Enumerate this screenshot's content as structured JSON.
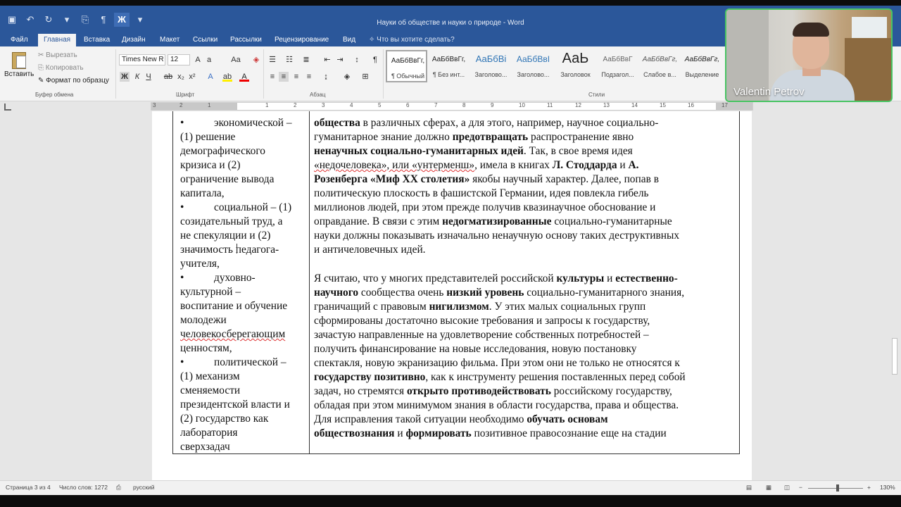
{
  "window": {
    "title": "Науки об обществе и науки о природе - Word"
  },
  "menu": {
    "tabs": [
      "Файл",
      "Главная",
      "Вставка",
      "Дизайн",
      "Макет",
      "Ссылки",
      "Рассылки",
      "Рецензирование",
      "Вид"
    ],
    "active": "Главная",
    "tell_me": "Что вы хотите сделать?"
  },
  "ribbon": {
    "clipboard": {
      "paste": "Вставить",
      "cut": "Вырезать",
      "copy": "Копировать",
      "format_painter": "Формат по образцу",
      "label": "Буфер обмена"
    },
    "font": {
      "name": "Times New R",
      "size": "12",
      "label": "Шрифт"
    },
    "paragraph": {
      "label": "Абзац"
    },
    "styles": {
      "label": "Стили",
      "items": [
        {
          "preview": "АаБбВвГг,",
          "name": "¶ Обычный"
        },
        {
          "preview": "АаБбВвГг,",
          "name": "¶ Без инт..."
        },
        {
          "preview": "АаБбВі",
          "name": "Заголово..."
        },
        {
          "preview": "АаБбВвІ",
          "name": "Заголово..."
        },
        {
          "preview": "АаЬ",
          "name": "Заголовок"
        },
        {
          "preview": "АаБбВвГ",
          "name": "Подзагол..."
        },
        {
          "preview": "АаБбВвГг,",
          "name": "Слабое в..."
        },
        {
          "preview": "АаБбВвГг,",
          "name": "Выделение"
        }
      ]
    }
  },
  "ruler": {
    "numbers": [
      "3",
      "2",
      "1",
      "1",
      "2",
      "3",
      "4",
      "5",
      "6",
      "7",
      "8",
      "9",
      "10",
      "11",
      "12",
      "13",
      "14",
      "15",
      "16",
      "17"
    ]
  },
  "document": {
    "left_column": [
      {
        "text": "экономической –",
        "bullet": true
      },
      {
        "text": "(1) решение"
      },
      {
        "text": "демографического"
      },
      {
        "text": "кризиса и (2)"
      },
      {
        "text": "ограничение вывода"
      },
      {
        "text": "капитала,"
      },
      {
        "text": "социальной – (1)",
        "bullet": true
      },
      {
        "text": "созидательный труд, а"
      },
      {
        "text": "не спекуляции и (2)"
      },
      {
        "text": "значимость педагога-"
      },
      {
        "text": "учителя,"
      },
      {
        "text": "духовно-",
        "bullet": true
      },
      {
        "text": "культурной –"
      },
      {
        "text": "воспитание и обучение"
      },
      {
        "text": "молодежи"
      },
      {
        "text": "человекосберегающим",
        "spell": true
      },
      {
        "text": "ценностям,"
      },
      {
        "text": "политической –",
        "bullet": true
      },
      {
        "text": "(1) механизм"
      },
      {
        "text": "сменяемости"
      },
      {
        "text": "президентской власти и"
      },
      {
        "text": "(2) государство как"
      },
      {
        "text": "лаборатория"
      },
      {
        "text": "сверхзадач"
      }
    ],
    "right_lines_p1": [
      [
        {
          "t": "общества",
          "b": true
        },
        {
          "t": " в различных сферах, а для этого, например, научное социально-"
        }
      ],
      [
        {
          "t": "гуманитарное знание должно "
        },
        {
          "t": "предотвращать",
          "b": true
        },
        {
          "t": " распространение явно"
        }
      ],
      [
        {
          "t": "ненаучных социально-гуманитарных идей",
          "b": true
        },
        {
          "t": ". Так, в свое время идея"
        }
      ],
      [
        {
          "t": "«недочеловека», или «унтерменш»",
          "s": true
        },
        {
          "t": ", имела в книгах "
        },
        {
          "t": "Л. Стоддарда",
          "b": true
        },
        {
          "t": " и "
        },
        {
          "t": "А.",
          "b": true
        }
      ],
      [
        {
          "t": "Розенберга «Миф XX столетия»",
          "b": true
        },
        {
          "t": " якобы научный характер. Далее, попав в"
        }
      ],
      [
        {
          "t": "политическую плоскость в фашистской Германии, идея повлекла гибель"
        }
      ],
      [
        {
          "t": "миллионов людей, при этом прежде получив квазинаучное обоснование и"
        }
      ],
      [
        {
          "t": "оправдание. В связи с этим "
        },
        {
          "t": "недогматизированные",
          "b": true
        },
        {
          "t": " социально-гуманитарные"
        }
      ],
      [
        {
          "t": "науки должны показывать изначально ненаучную основу таких деструктивных"
        }
      ],
      [
        {
          "t": "и античеловечных идей."
        }
      ]
    ],
    "right_lines_p2": [
      [
        {
          "t": "Я считаю, что у многих представителей российской "
        },
        {
          "t": "культуры",
          "b": true
        },
        {
          "t": " и "
        },
        {
          "t": "естественно-",
          "b": true
        }
      ],
      [
        {
          "t": "научного",
          "b": true
        },
        {
          "t": " сообщества очень "
        },
        {
          "t": "низкий уровень",
          "b": true
        },
        {
          "t": " социально-гуманитарного знания,"
        }
      ],
      [
        {
          "t": "граничащий с правовым "
        },
        {
          "t": "нигилизмом",
          "b": true
        },
        {
          "t": ". У этих малых социальных групп"
        }
      ],
      [
        {
          "t": "сформированы достаточно высокие требования и запросы к государству,"
        }
      ],
      [
        {
          "t": "зачастую направленные на удовлетворение собственных потребностей –"
        }
      ],
      [
        {
          "t": "получить финансирование на новые исследования, новую постановку"
        }
      ],
      [
        {
          "t": "спектакля, новую экранизацию фильма. При этом они не только не относятся к"
        }
      ],
      [
        {
          "t": "государству позитивно",
          "b": true
        },
        {
          "t": ", как к инструменту решения поставленных перед собой"
        }
      ],
      [
        {
          "t": "задач, но стремятся "
        },
        {
          "t": "открыто противодействовать",
          "b": true
        },
        {
          "t": " российскому государству,"
        }
      ],
      [
        {
          "t": "обладая при этом минимумом знания в области государства, права и общества."
        }
      ],
      [
        {
          "t": "Для исправления такой ситуации необходимо "
        },
        {
          "t": "обучать основам",
          "b": true
        }
      ],
      [
        {
          "t": "обществознания",
          "b": true
        },
        {
          "t": " и "
        },
        {
          "t": "формировать",
          "b": true
        },
        {
          "t": " позитивное правосознание еще на стадии"
        }
      ]
    ]
  },
  "status": {
    "page": "Страница 3 из 4",
    "words": "Число слов: 1272",
    "lang": "русский",
    "zoom": "130%"
  },
  "webcam": {
    "name": "Valentin Petrov"
  },
  "colors": {
    "word_blue": "#2b579a",
    "webcam_border": "#49c463"
  }
}
